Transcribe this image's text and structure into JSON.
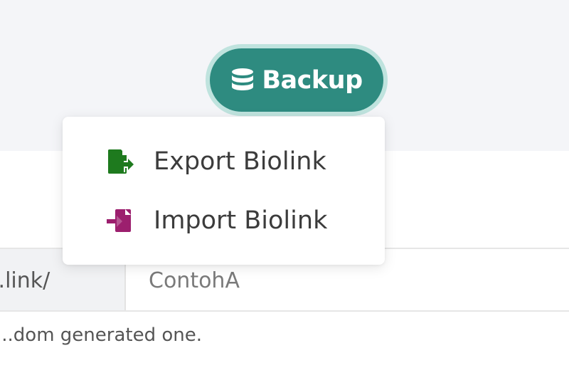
{
  "backup_button": {
    "label": "Backup",
    "icon": "database-icon",
    "color": "#2e8b80"
  },
  "backup_menu": {
    "items": [
      {
        "label": "Export Biolink",
        "icon": "file-export-icon",
        "icon_color": "#1e7a1e"
      },
      {
        "label": "Import Biolink",
        "icon": "file-import-icon",
        "icon_color": "#9c1f6e"
      }
    ]
  },
  "link_field": {
    "prefix": "..link/",
    "value": "ContohA"
  },
  "hint_text": "...dom generated one."
}
